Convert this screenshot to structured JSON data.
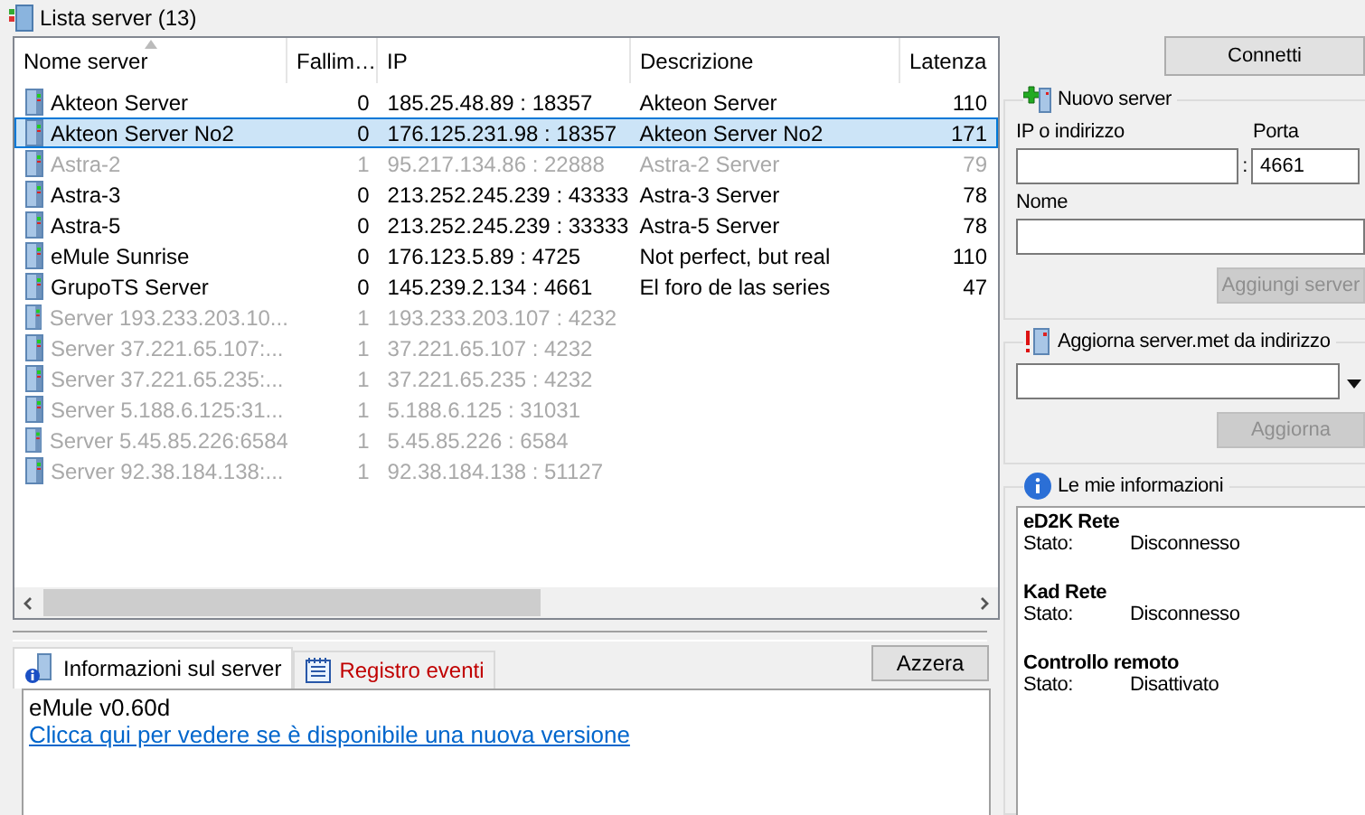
{
  "title": "Lista server (13)",
  "table": {
    "columns": [
      {
        "label": "Nome server",
        "sorted": true
      },
      {
        "label": "Fallim…",
        "sorted": false
      },
      {
        "label": "IP",
        "sorted": false
      },
      {
        "label": "Descrizione",
        "sorted": false
      },
      {
        "label": "Latenza",
        "sorted": false
      }
    ],
    "rows": [
      {
        "name": "Akteon Server",
        "failures": "0",
        "ip": "185.25.48.89 : 18357",
        "description": "Akteon Server",
        "latency": "110",
        "selected": false,
        "disabled": false
      },
      {
        "name": "Akteon Server No2",
        "failures": "0",
        "ip": "176.125.231.98 : 18357",
        "description": "Akteon Server No2",
        "latency": "171",
        "selected": true,
        "disabled": false
      },
      {
        "name": "Astra-2",
        "failures": "1",
        "ip": "95.217.134.86 : 22888",
        "description": "Astra-2 Server",
        "latency": "79",
        "selected": false,
        "disabled": true
      },
      {
        "name": "Astra-3",
        "failures": "0",
        "ip": "213.252.245.239 : 43333",
        "description": "Astra-3 Server",
        "latency": "78",
        "selected": false,
        "disabled": false
      },
      {
        "name": "Astra-5",
        "failures": "0",
        "ip": "213.252.245.239 : 33333",
        "description": "Astra-5 Server",
        "latency": "78",
        "selected": false,
        "disabled": false
      },
      {
        "name": "eMule Sunrise",
        "failures": "0",
        "ip": "176.123.5.89 : 4725",
        "description": "Not perfect, but real",
        "latency": "110",
        "selected": false,
        "disabled": false
      },
      {
        "name": "GrupoTS Server",
        "failures": "0",
        "ip": "145.239.2.134 : 4661",
        "description": "El foro de las series",
        "latency": "47",
        "selected": false,
        "disabled": false
      },
      {
        "name": "Server 193.233.203.10...",
        "failures": "1",
        "ip": "193.233.203.107 : 4232",
        "selected": false,
        "disabled": true
      },
      {
        "name": "Server 37.221.65.107:...",
        "failures": "1",
        "ip": "37.221.65.107 : 4232",
        "selected": false,
        "disabled": true
      },
      {
        "name": "Server 37.221.65.235:...",
        "failures": "1",
        "ip": "37.221.65.235 : 4232",
        "selected": false,
        "disabled": true
      },
      {
        "name": "Server 5.188.6.125:31...",
        "failures": "1",
        "ip": "5.188.6.125 : 31031",
        "selected": false,
        "disabled": true
      },
      {
        "name": "Server 5.45.85.226:6584",
        "failures": "1",
        "ip": "5.45.85.226 : 6584",
        "selected": false,
        "disabled": true
      },
      {
        "name": "Server 92.38.184.138:...",
        "failures": "1",
        "ip": "92.38.184.138 : 51127",
        "selected": false,
        "disabled": true
      }
    ]
  },
  "tabs": [
    {
      "label": "Informazioni sul server",
      "selected": true,
      "highlighted": false
    },
    {
      "label": "Registro eventi",
      "selected": false,
      "highlighted": true
    }
  ],
  "clear_button": "Azzera",
  "log": {
    "lines": [
      "eMule v0.60d"
    ],
    "link": "Clicca qui per vedere se è disponibile una nuova versione"
  },
  "connect_button": "Connetti",
  "new_server": {
    "title": "Nuovo server",
    "ip_label": "IP o indirizzo",
    "port_label": "Porta",
    "separator": ":",
    "port_value": "4661",
    "name_label": "Nome",
    "button": "Aggiungi server",
    "button_disabled": true
  },
  "update": {
    "title": "Aggiorna server.met da indirizzo",
    "button": "Aggiorna",
    "button_disabled": true
  },
  "my_info": {
    "title": "Le mie informazioni",
    "sections": [
      {
        "heading": "eD2K Rete",
        "rows": [
          {
            "label": "Stato:",
            "value": "Disconnesso"
          }
        ]
      },
      {
        "heading": "Kad Rete",
        "rows": [
          {
            "label": "Stato:",
            "value": "Disconnesso"
          }
        ]
      },
      {
        "heading": "Controllo remoto",
        "rows": [
          {
            "label": "Stato:",
            "value": "Disattivato"
          }
        ]
      }
    ]
  }
}
